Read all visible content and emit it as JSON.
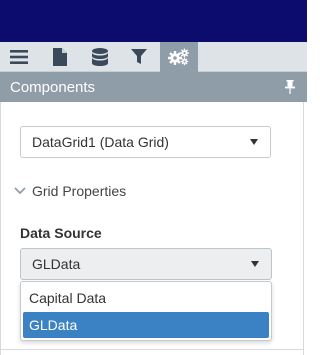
{
  "colors": {
    "topbar": "#0c0c6e",
    "toolbar": "#dee3e8",
    "active_tool": "#8f9da9",
    "panel_header": "#8f9da9",
    "selected_option": "#3b82c4"
  },
  "toolbar": {
    "items": [
      {
        "icon": "hamburger-menu-icon",
        "active": false
      },
      {
        "icon": "document-icon",
        "active": false
      },
      {
        "icon": "database-icon",
        "active": false
      },
      {
        "icon": "filter-icon",
        "active": false
      },
      {
        "icon": "gears-icon",
        "active": true
      }
    ]
  },
  "panel": {
    "title": "Components",
    "pin_icon": "pin-icon"
  },
  "component_select": {
    "value": "DataGrid1 (Data Grid)"
  },
  "section": {
    "title": "Grid Properties",
    "expanded": true
  },
  "data_source": {
    "label": "Data Source",
    "value": "GLData",
    "options": [
      "Capital Data",
      "GLData"
    ],
    "selected_index": 1
  }
}
